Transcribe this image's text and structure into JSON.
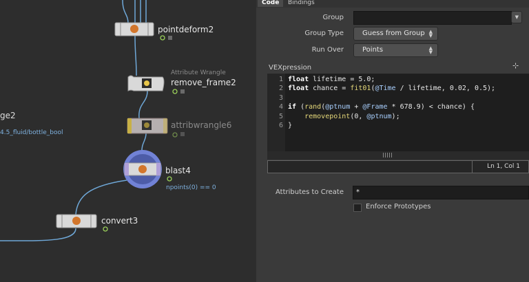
{
  "network": {
    "nodes": [
      {
        "name": "pointdeform2",
        "subtitle": "",
        "info": ""
      },
      {
        "name": "remove_frame2",
        "subtitle": "Attribute Wrangle",
        "info": ""
      },
      {
        "name": "attribwrangle6",
        "subtitle": "",
        "info": ""
      },
      {
        "name": "blast4",
        "subtitle": "",
        "info": "npoints(0) == 0"
      },
      {
        "name": "convert3",
        "subtitle": "",
        "info": ""
      }
    ],
    "partial_node_name": "ge2",
    "partial_node_path": "4.5_fluid/bottle_bool"
  },
  "params": {
    "tabs": [
      "Code",
      "Bindings"
    ],
    "group_label": "Group",
    "group_value": "",
    "group_type_label": "Group Type",
    "group_type_value": "Guess from Group",
    "run_over_label": "Run Over",
    "run_over_value": "Points",
    "vex_label": "VEXpression",
    "line_numbers": [
      "1",
      "2",
      "3",
      "4",
      "5",
      "6"
    ],
    "code_lines": [
      "float lifetime = 5.0;",
      "float chance = fit01(@Time / lifetime, 0.02, 0.5);",
      "",
      "if (rand(@ptnum + @Frame * 678.9) < chance) {",
      "    removepoint(0, @ptnum);",
      "}"
    ],
    "status_position": "Ln 1, Col 1",
    "attributes_label": "Attributes to Create",
    "attributes_value": "*",
    "enforce_label": "Enforce Prototypes"
  },
  "colors": {
    "network_bg": "#2d2d2d",
    "param_bg": "#3a3a3a",
    "wire": "#6fa8d8",
    "blast_ring": "#6b7fd0",
    "wrangle_highlight": "#e3c84a"
  }
}
